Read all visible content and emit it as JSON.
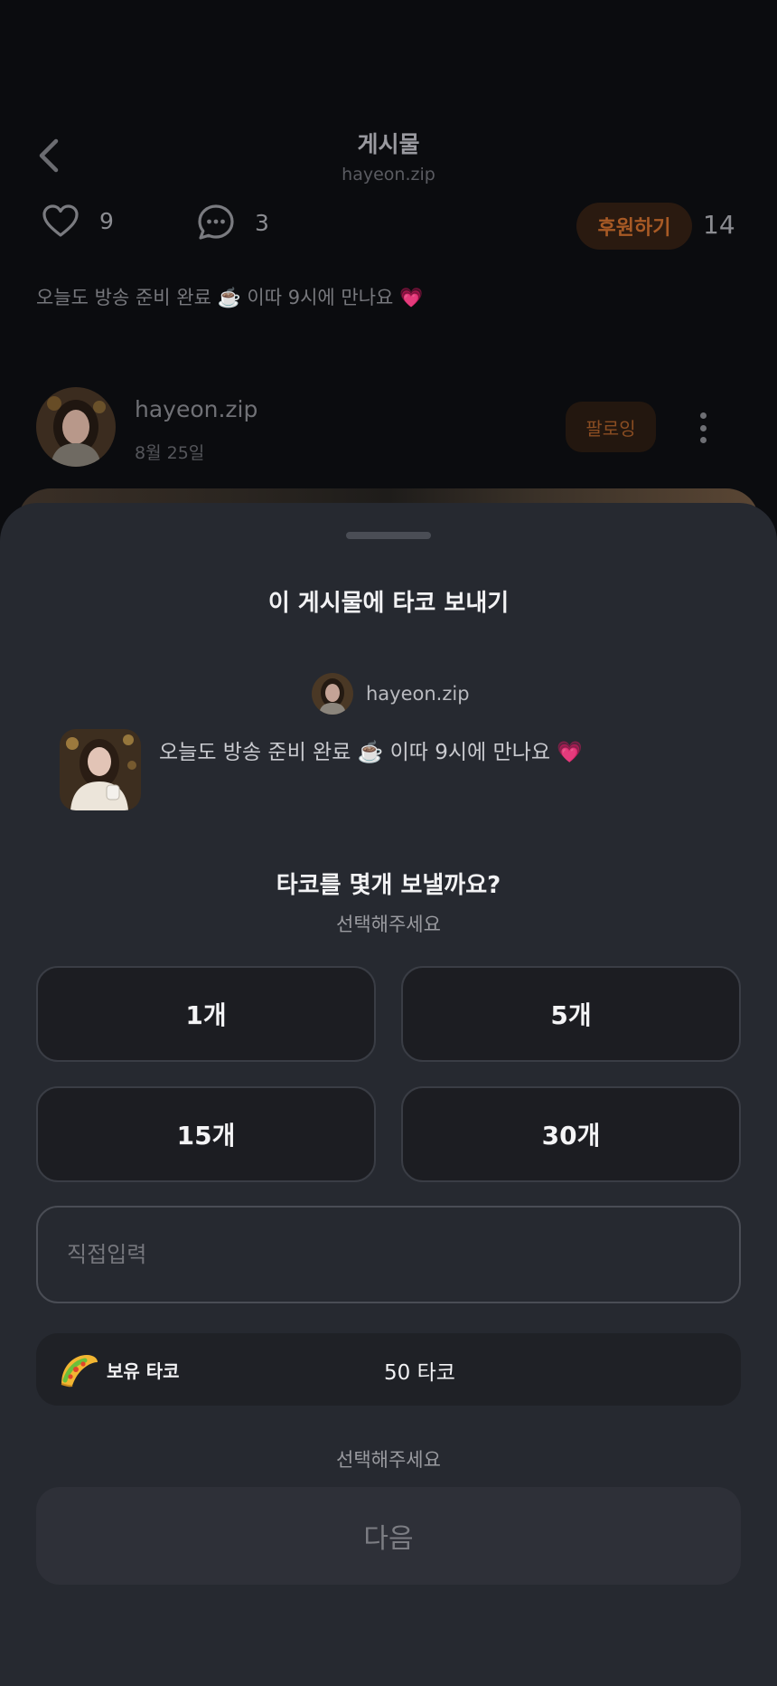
{
  "header": {
    "title": "게시물",
    "subtitle": "hayeon.zip"
  },
  "stats": {
    "likes": "9",
    "comments": "3",
    "donate_label": "후원하기",
    "donate_count": "14"
  },
  "post": {
    "caption": "오늘도 방송 준비 완료 ☕️ 이따 9시에 만나요 💗",
    "author": "hayeon.zip",
    "date": "8월 25일",
    "follow_label": "팔로잉"
  },
  "sheet": {
    "title": "이 게시물에 타코 보내기",
    "post_author": "hayeon.zip",
    "post_text": "오늘도 방송 준비 완료 ☕️ 이따 9시에 만나요 💗",
    "question": "타코를 몇개 보낼까요?",
    "question_sub": "선택해주세요",
    "options": [
      "1개",
      "5개",
      "15개",
      "30개"
    ],
    "custom_placeholder": "직접입력",
    "balance_label": "보유 타코",
    "balance_value": "50 타코",
    "hint": "선택해주세요",
    "next_label": "다음"
  },
  "colors": {
    "background": "#0b0c0f",
    "sheet": "#262930",
    "accent_orange": "#a85a25",
    "option_bg": "#1c1d22"
  },
  "icons": [
    "back-chevron-icon",
    "heart-icon",
    "comment-bubble-icon",
    "more-vertical-icon",
    "taco-icon"
  ]
}
